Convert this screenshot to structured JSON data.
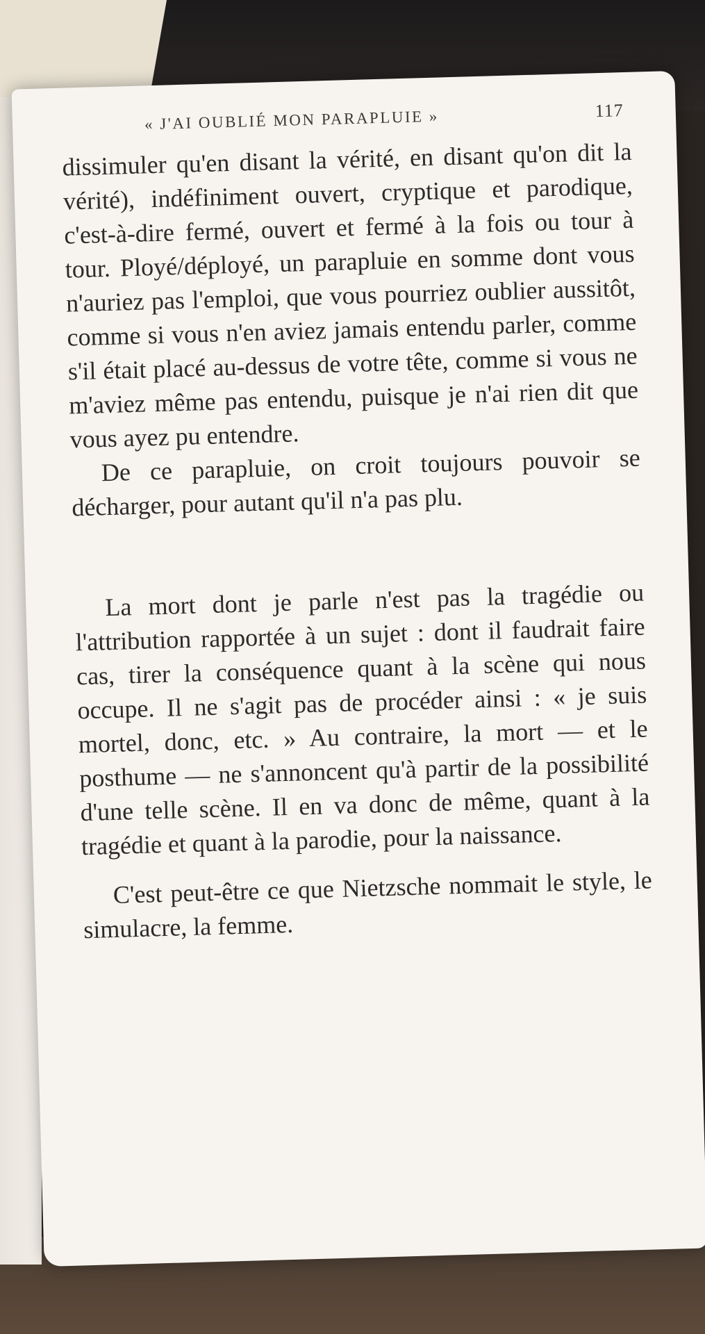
{
  "header": {
    "running_title": "« J'AI OUBLIÉ MON PARAPLUIE »",
    "page_number": "117"
  },
  "paragraphs": [
    "dissimuler qu'en disant la vérité, en disant qu'on dit la vérité), indéfiniment ouvert, cryptique et parodique, c'est-à-dire fermé, ouvert et fermé à la fois ou tour à tour. Ployé/déployé, un parapluie en somme dont vous n'auriez pas l'emploi, que vous pourriez oublier aussitôt, comme si vous n'en aviez jamais entendu parler, comme s'il était placé au-dessus de votre tête, comme si vous ne m'aviez même pas entendu, puisque je n'ai rien dit que vous ayez pu entendre.",
    "De ce parapluie, on croit toujours pouvoir se décharger, pour autant qu'il n'a pas plu.",
    "La mort dont je parle n'est pas la tragédie ou l'attribution rapportée à un sujet : dont il faudrait faire cas, tirer la conséquence quant à la scène qui nous occupe. Il ne s'agit pas de procéder ainsi : « je suis mortel, donc, etc. » Au contraire, la mort — et le posthume — ne s'annoncent qu'à partir de la possibilité d'une telle scène. Il en va donc de même, quant à la tragédie et quant à la parodie, pour la naissance.",
    "C'est peut-être ce que Nietzsche nommait le style, le simulacre, la femme."
  ]
}
